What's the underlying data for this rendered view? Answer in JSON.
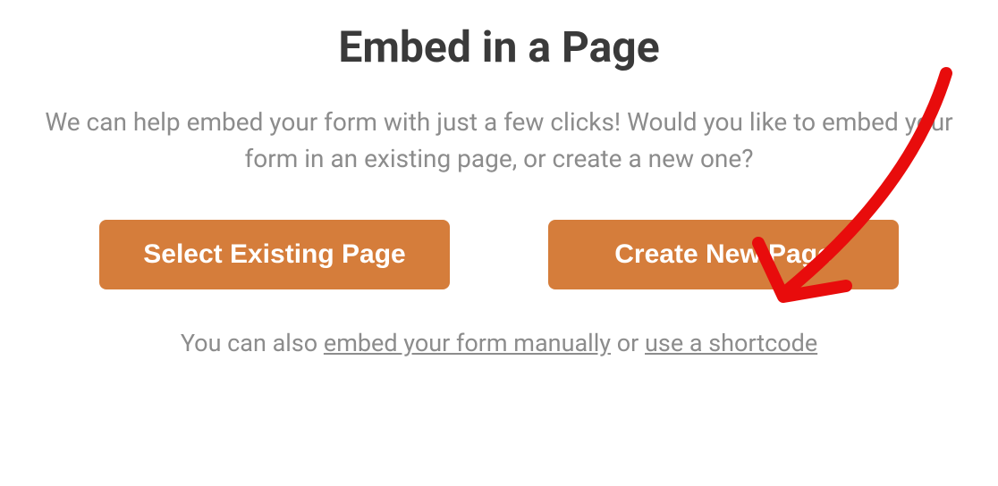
{
  "dialog": {
    "title": "Embed in a Page",
    "subtitle": "We can help embed your form with just a few clicks! Would you like to embed your form in an existing page, or create a new one?",
    "buttons": {
      "existing": "Select Existing Page",
      "new": "Create New Page"
    },
    "footer": {
      "prefix": "You can also ",
      "link_manual": "embed your form manually",
      "middle": " or ",
      "link_shortcode": "use a shortcode"
    }
  },
  "annotation": {
    "type": "hand-drawn-arrow",
    "color": "#e80c0c",
    "points_to": "create-new-page-button"
  }
}
